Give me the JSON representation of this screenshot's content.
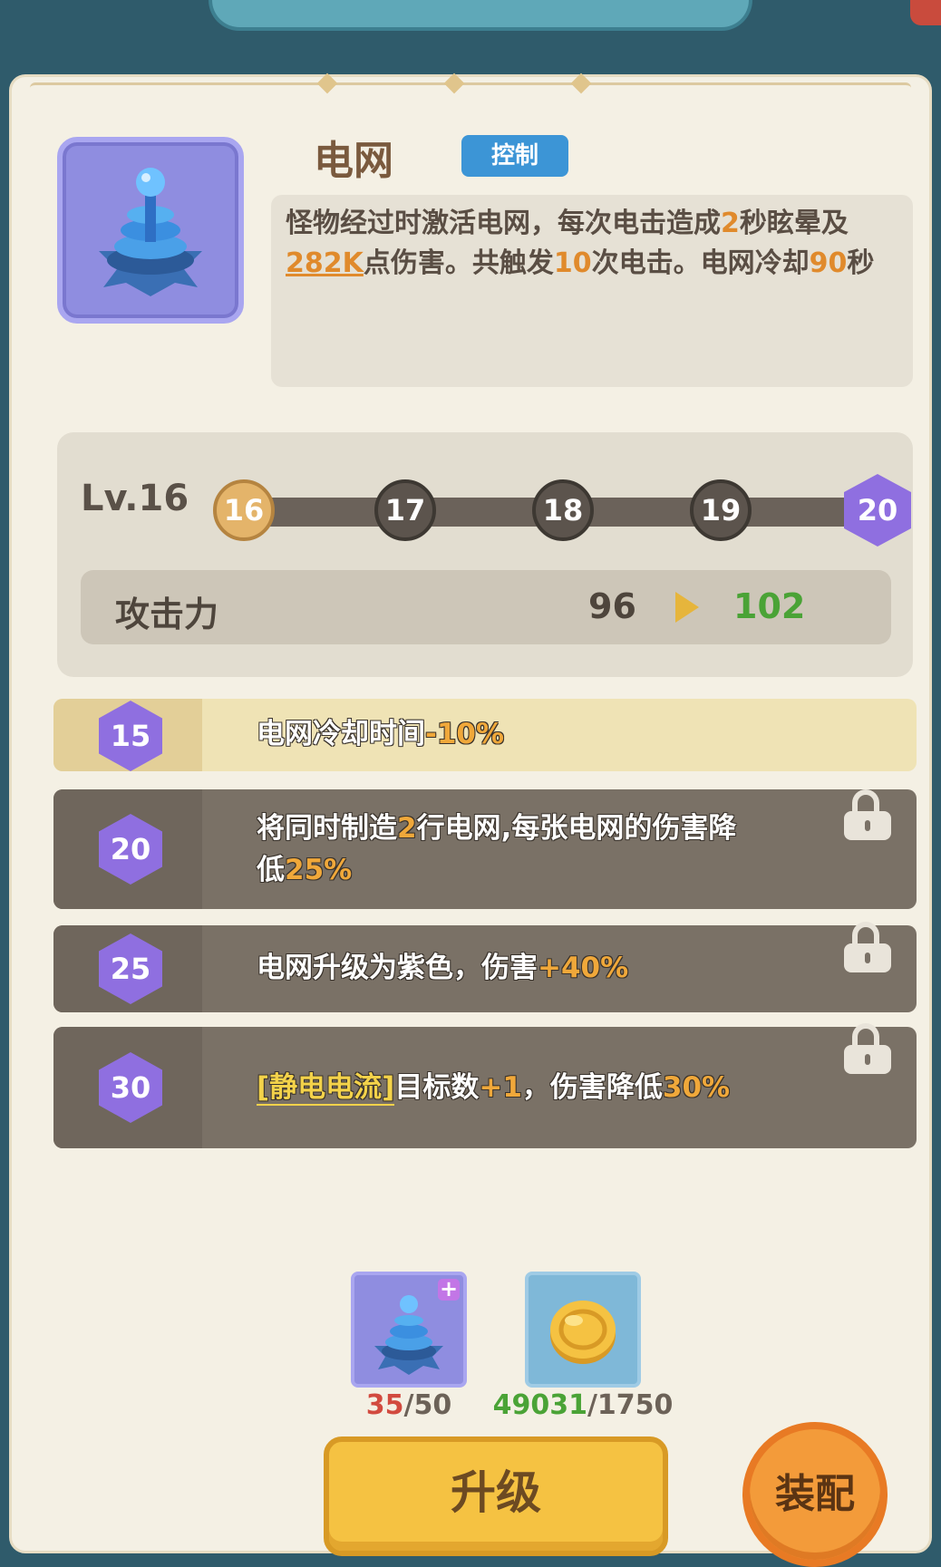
{
  "tower": {
    "name": "电网",
    "tag": "控制",
    "icon": "electric-tower-icon",
    "description": {
      "p1": "怪物经过时激活电网，每次电击造成",
      "stun_seconds": "2",
      "p2": "秒眩晕及",
      "damage": "282K",
      "p3": "点伤害。共触发",
      "shocks": "10",
      "p4": "次电击。电网冷却",
      "cooldown": "90",
      "p5": "秒"
    }
  },
  "level": {
    "label": "Lv.16",
    "nodes": [
      "16",
      "17",
      "18",
      "19",
      "20"
    ],
    "current": "16",
    "max": "20"
  },
  "stat": {
    "name": "攻击力",
    "current": "96",
    "next": "102"
  },
  "unlocks": [
    {
      "level": "15",
      "a": "电网冷却时间",
      "b": "-10%",
      "c": "",
      "locked": false
    },
    {
      "level": "20",
      "a": "将同时制造",
      "b": "2",
      "c": "行电网,每张电网的伤害降",
      "d": "低",
      "e": "25%",
      "locked": true
    },
    {
      "level": "25",
      "a": "电网升级为紫色，伤害",
      "b": "+40%",
      "locked": true
    },
    {
      "level": "30",
      "kw": "[静电电流]",
      "a": "目标数",
      "b": "+1",
      "c": "，伤害降低",
      "d": "30%",
      "locked": true
    }
  ],
  "materials": {
    "tower_cards": {
      "have": "35",
      "need": "/50",
      "icon": "electric-tower-card-icon"
    },
    "coins": {
      "have": "49031",
      "need": "/1750",
      "icon": "gold-coin-icon"
    }
  },
  "buttons": {
    "upgrade": "升级",
    "equip": "装配"
  },
  "colors": {
    "highlight": "#e08a2c",
    "tag_blue": "#3c95d6",
    "hex_purple": "#8f6fe0",
    "button_gold": "#f5c242",
    "button_orange": "#f39b3a",
    "next_value_green": "#4aa336"
  }
}
